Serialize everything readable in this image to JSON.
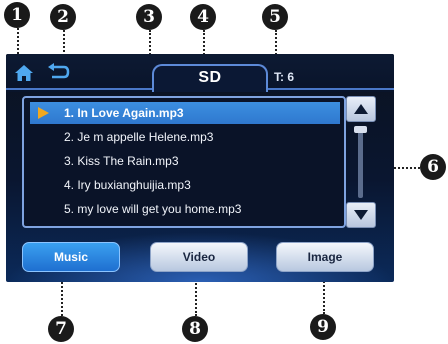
{
  "callouts": [
    "1",
    "2",
    "3",
    "4",
    "5",
    "6",
    "7",
    "8",
    "9"
  ],
  "header": {
    "source_tab": "SD",
    "track_info": "T: 6"
  },
  "playlist": {
    "items": [
      "1. In Love Again.mp3",
      "2. Je m appelle Helene.mp3",
      "3. Kiss The Rain.mp3",
      "4. Iry buxianghuijia.mp3",
      "5. my love will get you home.mp3"
    ],
    "selected_index": 0
  },
  "tabs": {
    "music": "Music",
    "video": "Video",
    "image": "Image",
    "active": "music"
  },
  "icons": {
    "home": "home-icon",
    "back": "back-arrow-icon",
    "play": "play-icon",
    "scroll_up": "arrow-up-icon",
    "scroll_down": "arrow-down-icon"
  },
  "colors": {
    "screen_bg": "#0b1220",
    "accent_blue": "#3c8fe0",
    "play_orange": "#f0a820",
    "border_blue": "#7fa3e0"
  }
}
